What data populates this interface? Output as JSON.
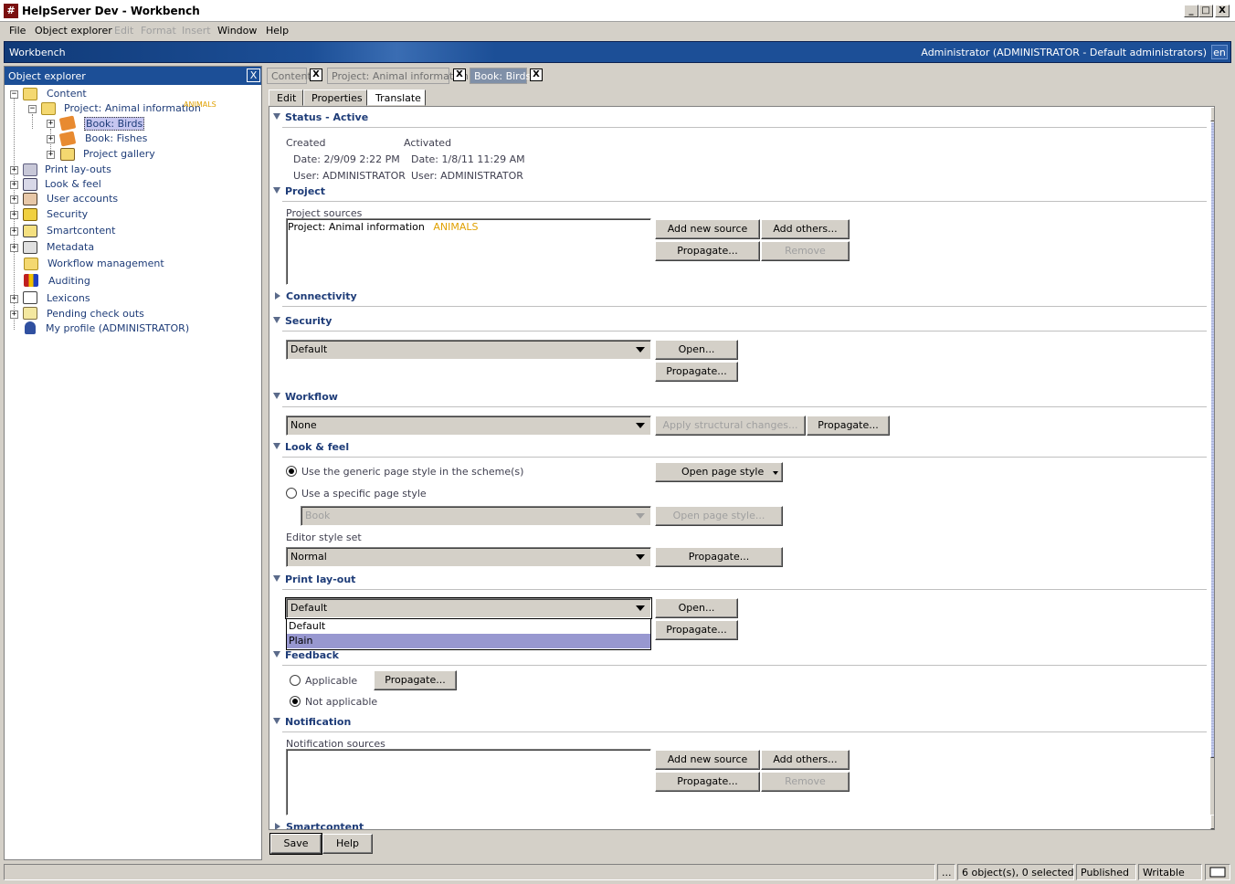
{
  "window": {
    "title": "HelpServer Dev - Workbench",
    "app_icon": "#",
    "min": "_",
    "max": "□",
    "close": "X"
  },
  "menu": [
    "File",
    "Object explorer",
    "Edit",
    "Format",
    "Insert",
    "Window",
    "Help"
  ],
  "menu_disabled": [
    "Edit",
    "Format",
    "Insert"
  ],
  "bluebar": {
    "label": "Workbench",
    "user": "Administrator (ADMINISTRATOR - Default administrators)",
    "lang": "en"
  },
  "explorer": {
    "title": "Object explorer",
    "close": "X",
    "tree": [
      {
        "label": "Content"
      },
      {
        "label": "Project: Animal information",
        "badge": "ANIMALS"
      },
      {
        "label": "Book: Birds"
      },
      {
        "label": "Book: Fishes"
      },
      {
        "label": "Project gallery"
      },
      {
        "label": "Print lay-outs"
      },
      {
        "label": "Look & feel"
      },
      {
        "label": "User accounts"
      },
      {
        "label": "Security"
      },
      {
        "label": "Smartcontent"
      },
      {
        "label": "Metadata"
      },
      {
        "label": "Workflow management"
      },
      {
        "label": "Auditing"
      },
      {
        "label": "Lexicons"
      },
      {
        "label": "Pending check outs"
      },
      {
        "label": "My profile (ADMINISTRATOR)"
      }
    ]
  },
  "doctabs": [
    {
      "label": "Content",
      "close": "X"
    },
    {
      "label": "Project: Animal information",
      "close": "X"
    },
    {
      "label": "Book: Birds",
      "close": "X"
    }
  ],
  "subtabs": [
    "Edit",
    "Properties",
    "Translate"
  ],
  "sections": {
    "status": {
      "title": "Status - Active",
      "created_label": "Created",
      "created_date": "Date:  2/9/09 2:22 PM",
      "created_user": "User:  ADMINISTRATOR",
      "activated_label": "Activated",
      "activated_date": "Date:  1/8/11 11:29 AM",
      "activated_user": "User:  ADMINISTRATOR"
    },
    "project": {
      "title": "Project",
      "sources_label": "Project sources",
      "source_item": "Project: Animal information",
      "source_badge": "ANIMALS",
      "add_new": "Add new source",
      "add_others": "Add others...",
      "propagate": "Propagate...",
      "remove": "Remove"
    },
    "connectivity": {
      "title": "Connectivity"
    },
    "security": {
      "title": "Security",
      "value": "Default",
      "open": "Open...",
      "propagate": "Propagate..."
    },
    "workflow": {
      "title": "Workflow",
      "value": "None",
      "apply": "Apply structural changes...",
      "propagate": "Propagate..."
    },
    "lookfeel": {
      "title": "Look & feel",
      "radio_generic": "Use the generic page style in the scheme(s)",
      "radio_specific": "Use a specific page style",
      "open_page_style": "Open page style",
      "style_value": "Book",
      "open_page_style_disabled": "Open page style...",
      "editor_label": "Editor style set",
      "editor_value": "Normal",
      "propagate": "Propagate..."
    },
    "print": {
      "title": "Print lay-out",
      "value": "Default",
      "options": [
        "Default",
        "Plain"
      ],
      "open": "Open...",
      "propagate": "Propagate..."
    },
    "feedback": {
      "title": "Feedback",
      "applicable": "Applicable",
      "not_applicable": "Not applicable",
      "propagate": "Propagate..."
    },
    "notification": {
      "title": "Notification",
      "sources_label": "Notification sources",
      "add_new": "Add new source",
      "add_others": "Add others...",
      "propagate": "Propagate...",
      "remove": "Remove"
    },
    "smartcontent": {
      "title": "Smartcontent"
    }
  },
  "footer": {
    "save": "Save",
    "help": "Help"
  },
  "status": {
    "ellipsis": "...",
    "objects": "6 object(s), 0 selected",
    "state": "Published",
    "mode": "Writable"
  }
}
